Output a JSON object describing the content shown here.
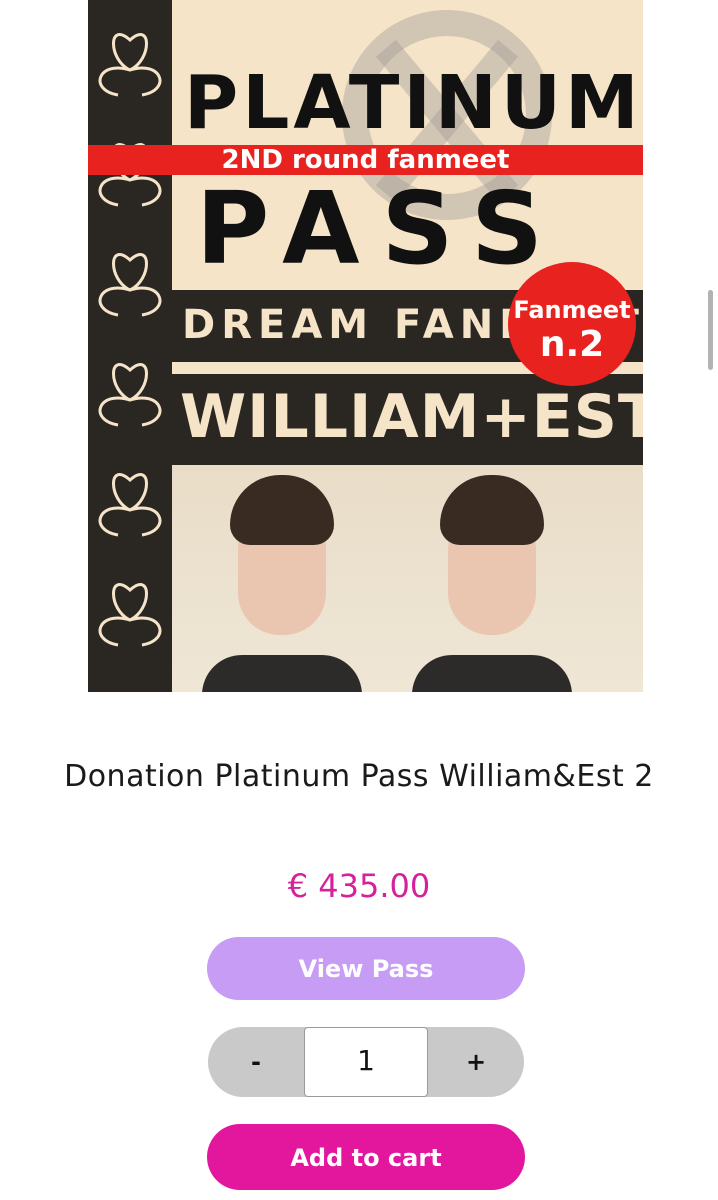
{
  "product": {
    "image": {
      "poster_line_platinum": "PLATINUM",
      "poster_band": "2ND round fanmeet",
      "poster_line_pass": "PASS",
      "poster_line_dream": "DREAM FANMEET",
      "poster_line_names": "WILLIAM+EST",
      "badge_line1": "Fanmeet",
      "badge_line2": "n.2"
    },
    "title": "Donation Platinum Pass William&Est 2",
    "price": "€ 435.00",
    "view_button": "View Pass",
    "quantity": {
      "minus": "-",
      "value": "1",
      "plus": "+"
    },
    "add_button": "Add to cart"
  },
  "colors": {
    "price": "#d4239a",
    "view_button": "#c79cf4",
    "add_button": "#e2179e",
    "stepper": "#c9c9c9"
  },
  "icons": {
    "poster_emblem": "circle-cross-emblem",
    "poster_pattern": "lotus-pattern"
  }
}
